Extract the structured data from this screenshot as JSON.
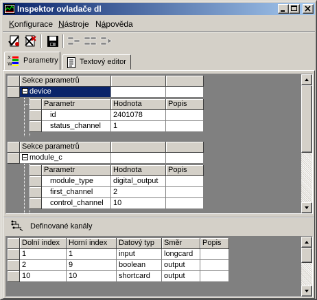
{
  "window": {
    "title": "Inspektor ovladače dl"
  },
  "menu": [
    {
      "label": "Konfigurace",
      "underline": "K"
    },
    {
      "label": "Nástroje",
      "underline": "N"
    },
    {
      "label": "Nápověda",
      "underline": "á"
    }
  ],
  "tabs": [
    {
      "label": "Parametry",
      "active": true
    },
    {
      "label": "Textový editor",
      "active": false
    }
  ],
  "params": {
    "section_header": "Sekce parametrů",
    "sections": [
      {
        "name": "device",
        "selected": true,
        "col_headers": [
          "Parametr",
          "Hodnota",
          "Popis"
        ],
        "rows": [
          {
            "param": "id",
            "value": "2401078",
            "desc": ""
          },
          {
            "param": "status_channel",
            "value": "1",
            "desc": ""
          }
        ]
      },
      {
        "name": "module_c",
        "selected": false,
        "col_headers": [
          "Parametr",
          "Hodnota",
          "Popis"
        ],
        "rows": [
          {
            "param": "module_type",
            "value": "digital_output",
            "desc": ""
          },
          {
            "param": "first_channel",
            "value": "2",
            "desc": ""
          },
          {
            "param": "control_channel",
            "value": "10",
            "desc": ""
          }
        ]
      }
    ]
  },
  "channels": {
    "title": "Definované kanály",
    "columns": [
      "Dolní index",
      "Horní index",
      "Datový typ",
      "Směr",
      "Popis"
    ],
    "rows": [
      [
        "1",
        "1",
        "input",
        "longcard",
        ""
      ],
      [
        "2",
        "9",
        "boolean",
        "output",
        ""
      ],
      [
        "10",
        "10",
        "shortcard",
        "output",
        ""
      ]
    ]
  }
}
